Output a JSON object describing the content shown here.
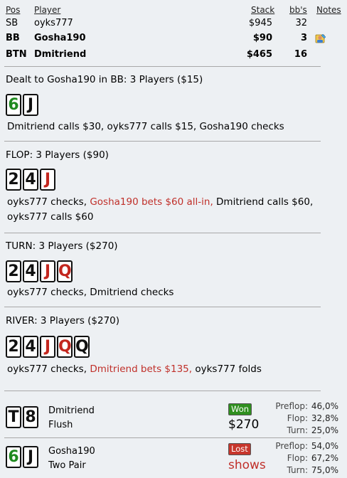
{
  "table": {
    "headers": {
      "pos": "Pos",
      "player": "Player",
      "stack": "Stack",
      "bbs": "bb's",
      "notes": "Notes"
    },
    "rows": [
      {
        "pos": "SB",
        "player": "oyks777",
        "stack": "$945",
        "bbs": "32",
        "bold": false,
        "note": false
      },
      {
        "pos": "BB",
        "player": "Gosha190",
        "stack": "$90",
        "bbs": "3",
        "bold": true,
        "note": true
      },
      {
        "pos": "BTN",
        "player": "Dmitriend",
        "stack": "$465",
        "bbs": "16",
        "bold": true,
        "note": false
      }
    ]
  },
  "preflop": {
    "title": "Dealt to Gosha190 in BB: 3 Players ($15)",
    "cards": [
      {
        "rank": "6",
        "suit": "green"
      },
      {
        "rank": "J",
        "suit": "black"
      }
    ],
    "action": "Dmitriend calls $30, oyks777 calls $15, Gosha190 checks"
  },
  "flop": {
    "title": "FLOP: 3 Players ($90)",
    "cards": [
      {
        "rank": "2",
        "suit": "black"
      },
      {
        "rank": "4",
        "suit": "black"
      },
      {
        "rank": "J",
        "suit": "red"
      }
    ],
    "action_a": "oyks777 checks, ",
    "action_b": "Gosha190 bets $60 all-in,",
    "action_c": " Dmitriend calls $60,",
    "action_d": "oyks777 calls $60"
  },
  "turn": {
    "title": "TURN: 3 Players ($270)",
    "cards": [
      {
        "rank": "2",
        "suit": "black"
      },
      {
        "rank": "4",
        "suit": "black"
      },
      {
        "rank": "J",
        "suit": "red"
      },
      {
        "rank": "Q",
        "suit": "red"
      }
    ],
    "action": "oyks777 checks, Dmitriend checks"
  },
  "river": {
    "title": "RIVER: 3 Players ($270)",
    "cards": [
      {
        "rank": "2",
        "suit": "black"
      },
      {
        "rank": "4",
        "suit": "black"
      },
      {
        "rank": "J",
        "suit": "red"
      },
      {
        "rank": "Q",
        "suit": "red"
      },
      {
        "rank": "Q",
        "suit": "black"
      }
    ],
    "action_a": "oyks777 checks, ",
    "action_b": "Dmitriend bets $135,",
    "action_c": " oyks777 folds"
  },
  "results": [
    {
      "cards": [
        {
          "rank": "T",
          "suit": "black"
        },
        {
          "rank": "8",
          "suit": "black"
        }
      ],
      "player": "Dmitriend",
      "hand": "Flush",
      "badge": "Won",
      "badge_type": "won",
      "amount": "$270",
      "equity": {
        "preflop_label": "Preflop:",
        "preflop": "46,0%",
        "flop_label": "Flop:",
        "flop": "32,8%",
        "turn_label": "Turn:",
        "turn": "25,0%"
      }
    },
    {
      "cards": [
        {
          "rank": "6",
          "suit": "green"
        },
        {
          "rank": "J",
          "suit": "black"
        }
      ],
      "player": "Gosha190",
      "hand": "Two Pair",
      "badge": "Lost",
      "badge_type": "lost",
      "amount": "shows",
      "equity": {
        "preflop_label": "Preflop:",
        "preflop": "54,0%",
        "flop_label": "Flop:",
        "flop": "67,2%",
        "turn_label": "Turn:",
        "turn": "75,0%"
      }
    }
  ]
}
